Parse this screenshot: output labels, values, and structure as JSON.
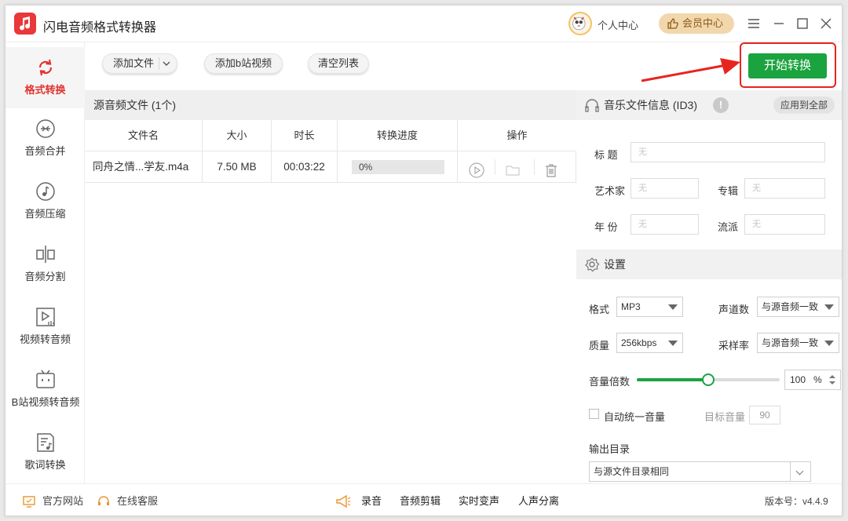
{
  "app": {
    "title": "闪电音频格式转换器",
    "user_center": "个人中心",
    "vip_label": "会员中心",
    "accent_color": "#e2322f",
    "primary_color": "#1aa33e"
  },
  "titlebar_icons": [
    "menu-icon",
    "minimize-icon",
    "maximize-icon",
    "close-icon"
  ],
  "sidebar": {
    "items": [
      {
        "label": "格式转换",
        "icon": "format-convert-icon",
        "active": true
      },
      {
        "label": "音频合并",
        "icon": "audio-merge-icon",
        "active": false
      },
      {
        "label": "音频压缩",
        "icon": "audio-compress-icon",
        "active": false
      },
      {
        "label": "音频分割",
        "icon": "audio-split-icon",
        "active": false
      },
      {
        "label": "视频转音频",
        "icon": "video-to-audio-icon",
        "active": false
      },
      {
        "label": "B站视频转音频",
        "icon": "bilibili-icon",
        "active": false
      },
      {
        "label": "歌词转换",
        "icon": "lyrics-icon",
        "active": false
      }
    ]
  },
  "toolbar": {
    "add_file": "添加文件",
    "add_bilibili": "添加b站视频",
    "clear_list": "清空列表",
    "start": "开始转换"
  },
  "file_list": {
    "header": "源音频文件 (1个)",
    "columns": [
      "文件名",
      "大小",
      "时长",
      "转换进度",
      "操作"
    ],
    "rows": [
      {
        "name": "同舟之情...学友.m4a",
        "size": "7.50 MB",
        "duration": "00:03:22",
        "progress_text": "0%",
        "progress": 0
      }
    ]
  },
  "id3": {
    "title": "音乐文件信息 (ID3)",
    "apply_all": "应用到全部",
    "fields": {
      "title_label": "标  题",
      "artist_label": "艺术家",
      "album_label": "专辑",
      "year_label": "年  份",
      "genre_label": "流派",
      "empty_value": "无"
    }
  },
  "settings": {
    "title": "设置",
    "format_label": "格式",
    "format_value": "MP3",
    "channels_label": "声道数",
    "channels_value": "与源音频一致",
    "quality_label": "质量",
    "quality_value": "256kbps",
    "samplerate_label": "采样率",
    "samplerate_value": "与源音频一致",
    "volume_label": "音量倍数",
    "volume_value": "100",
    "volume_unit": "%",
    "volume_level": 0.5,
    "auto_volume_label": "自动统一音量",
    "target_volume_label": "目标音量",
    "target_volume_value": "90",
    "output_dir_label": "输出目录",
    "output_dir_value": "与源文件目录相同"
  },
  "statusbar": {
    "website": "官方网站",
    "support": "在线客服",
    "tools": [
      "录音",
      "音频剪辑",
      "实时变声",
      "人声分离"
    ],
    "version": "版本号：v4.4.9"
  }
}
